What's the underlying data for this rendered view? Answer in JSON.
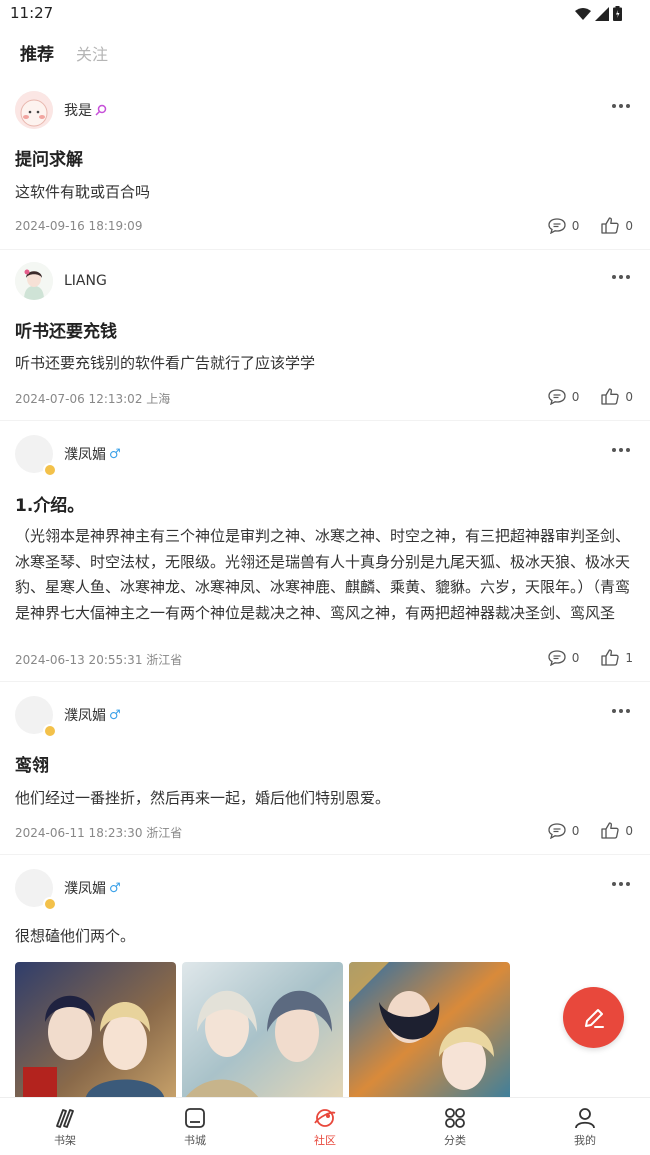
{
  "status_bar": {
    "time": "11:27"
  },
  "tabs": [
    {
      "label": "推荐",
      "active": true
    },
    {
      "label": "关注",
      "active": false
    }
  ],
  "posts": [
    {
      "user": "我是",
      "badge": "search",
      "title": "提问求解",
      "body": "这软件有耽或百合吗",
      "meta": "2024-09-16 18:19:09",
      "comments": "0",
      "likes": "0"
    },
    {
      "user": "LIANG",
      "title": "听书还要充钱",
      "body": "听书还要充钱别的软件看广告就行了应该学学",
      "meta": "2024-07-06 12:13:02 上海",
      "comments": "0",
      "likes": "0"
    },
    {
      "user": "濮凤媚",
      "gender": "♂",
      "title": "1.介绍。",
      "body": "（光翎本是神界神主有三个神位是审判之神、冰寒之神、时空之神，有三把超神器审判圣剑、冰寒圣琴、时空法杖，无限级。光翎还是瑞兽有人十真身分别是九尾天狐、极冰天狼、极冰天豹、星寒人鱼、冰寒神龙、冰寒神凤、冰寒神鹿、麒麟、乘黄、貔貅。六岁，天限年。）（青鸾是神界七大偪神主之一有两个神位是裁决之神、鸾风之神，有两把超神器裁决圣剑、鸾风圣剑，无限级，是魂兽极风天狼、极风天豹、风...",
      "meta": "2024-06-13 20:55:31 浙江省",
      "comments": "0",
      "likes": "1"
    },
    {
      "user": "濮凤媚",
      "gender": "♂",
      "title": "鸾翎",
      "body": "他们经过一番挫折，然后再来一起，婚后他们特别恩爱。",
      "meta": "2024-06-11 18:23:30 浙江省",
      "comments": "0",
      "likes": "0"
    },
    {
      "user": "濮凤媚",
      "gender": "♂",
      "body": "很想磕他们两个。"
    }
  ],
  "nav": [
    {
      "label": "书架",
      "icon": "bookshelf-icon"
    },
    {
      "label": "书城",
      "icon": "bookstore-icon"
    },
    {
      "label": "社区",
      "icon": "community-icon",
      "active": true
    },
    {
      "label": "分类",
      "icon": "category-icon"
    },
    {
      "label": "我的",
      "icon": "profile-icon"
    }
  ],
  "colors": {
    "accent": "#e8483c",
    "vip": "#f3c14a",
    "male": "#3aa0e8"
  }
}
